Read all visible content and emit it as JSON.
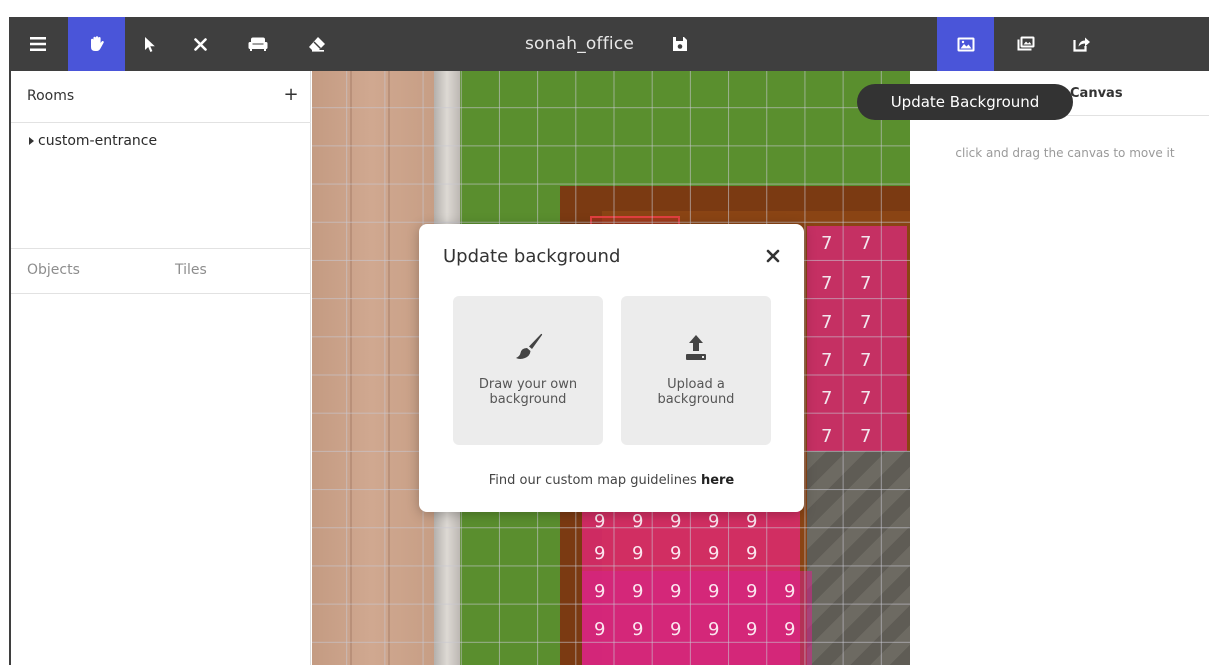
{
  "app": {
    "title": "sonah_office"
  },
  "toolbar": {
    "tools": [
      {
        "name": "menu-icon"
      },
      {
        "name": "hand-icon",
        "active": true
      },
      {
        "name": "pointer-icon"
      },
      {
        "name": "delete-icon"
      },
      {
        "name": "furniture-icon"
      },
      {
        "name": "eraser-icon"
      }
    ],
    "save_icon": "floppy-disk-icon",
    "right_tools": [
      {
        "name": "update-background-icon",
        "active": true
      },
      {
        "name": "images-icon"
      },
      {
        "name": "share-icon"
      }
    ],
    "accent_color": "#4a55d9"
  },
  "sidebar": {
    "rooms_label": "Rooms",
    "add_label": "+",
    "rooms": [
      {
        "label": "custom-entrance"
      }
    ],
    "tabs": [
      {
        "label": "Objects"
      },
      {
        "label": "Tiles"
      }
    ]
  },
  "canvas": {
    "sevens": [
      "7",
      "7",
      "7",
      "7",
      "7",
      "7",
      "7",
      "7",
      "7",
      "7",
      "7",
      "7"
    ],
    "nines": [
      "9",
      "9",
      "9",
      "9",
      "9",
      "9",
      "9",
      "9",
      "9",
      "9",
      "9",
      "9",
      "9",
      "9",
      "9",
      "9",
      "9",
      "9",
      "9",
      "9",
      "9",
      "9"
    ]
  },
  "right_panel": {
    "title": "Canvas",
    "hint": "click and drag the canvas to move it"
  },
  "tooltip": {
    "text": "Update Background"
  },
  "modal": {
    "title": "Update background",
    "options": [
      {
        "label": "Draw your own\nbackground",
        "icon": "paintbrush-icon"
      },
      {
        "label": "Upload a\nbackground",
        "icon": "upload-icon"
      }
    ],
    "footer_text": "Find our custom map guidelines ",
    "footer_link": "here"
  }
}
